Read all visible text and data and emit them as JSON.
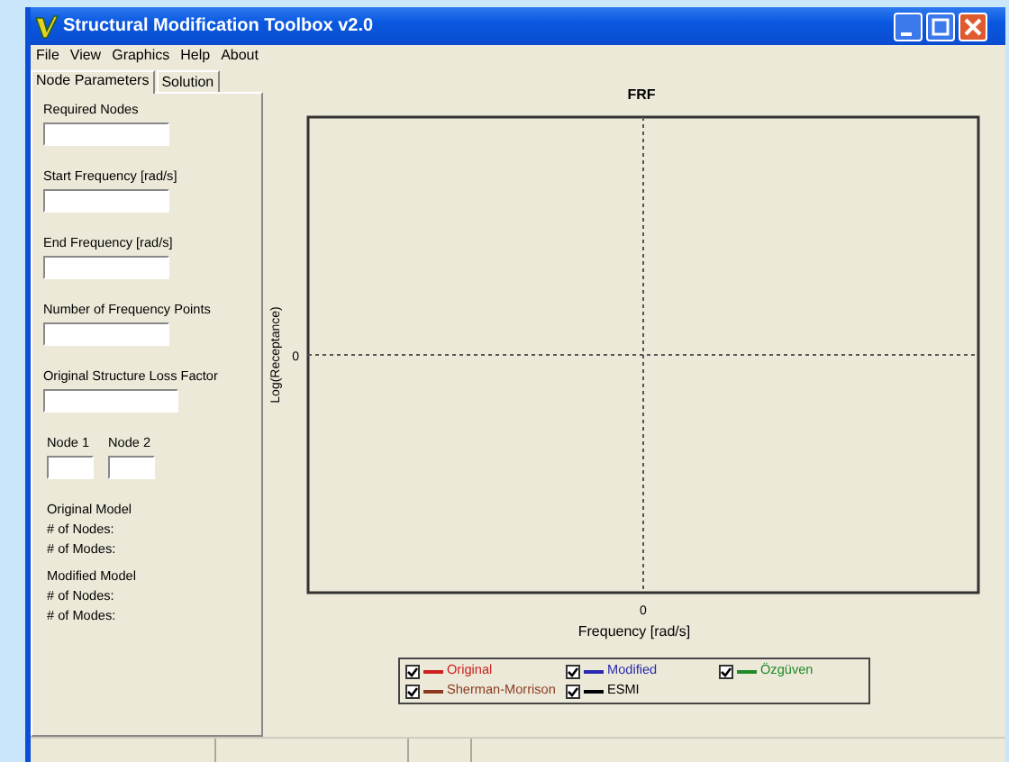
{
  "window": {
    "title": "Structural Modification Toolbox v2.0"
  },
  "menu": [
    "File",
    "View",
    "Graphics",
    "Help",
    "About"
  ],
  "tabs": [
    {
      "label": "Node Parameters",
      "selected": true
    },
    {
      "label": "Solution",
      "selected": false
    }
  ],
  "fields": [
    {
      "label": "Required Nodes",
      "wide": false
    },
    {
      "label": "Start Frequency [rad/s]",
      "wide": false
    },
    {
      "label": "End Frequency [rad/s]",
      "wide": false
    },
    {
      "label": "Number of Frequency Points",
      "wide": false
    },
    {
      "label": "Original Structure Loss Factor",
      "wide": true
    }
  ],
  "nodes": [
    {
      "label": "Node 1"
    },
    {
      "label": "Node 2"
    }
  ],
  "models": [
    {
      "title": "Original Model",
      "lines": [
        "# of Nodes:",
        "# of Modes:"
      ]
    },
    {
      "title": "Modified Model",
      "lines": [
        "# of Nodes:",
        "# of Modes:"
      ]
    }
  ],
  "plot": {
    "title": "FRF",
    "xlabel": "Frequency [rad/s]",
    "ylabel": "Log(Receptance)",
    "x_tick": "0",
    "y_tick": "0"
  },
  "legend": [
    {
      "label": "Original",
      "checked": true,
      "color": "#cc2020"
    },
    {
      "label": "Modified",
      "checked": true,
      "color": "#2828b0"
    },
    {
      "label": "Özgüven",
      "checked": true,
      "color": "#208a28"
    },
    {
      "label": "Sherman-Morrison",
      "checked": true,
      "color": "#8a3a20"
    },
    {
      "label": "ESMI",
      "checked": true,
      "color": "#000000"
    }
  ]
}
